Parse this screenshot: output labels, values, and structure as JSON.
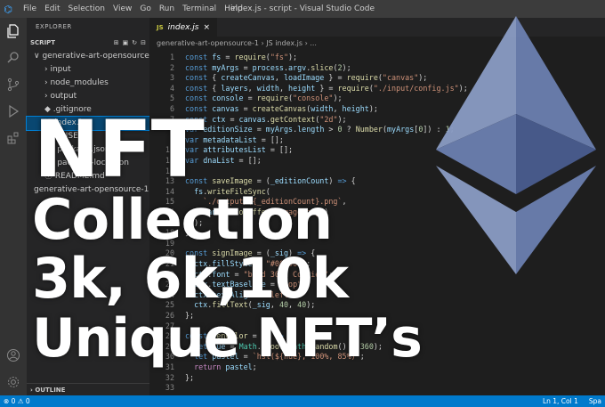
{
  "titlebar": {
    "logo": "⌬",
    "menus": [
      "File",
      "Edit",
      "Selection",
      "View",
      "Go",
      "Run",
      "Terminal",
      "Help"
    ],
    "window_title": "index.js - script - Visual Studio Code"
  },
  "activity": {
    "top": [
      "files-icon",
      "search-icon",
      "source-control-icon",
      "run-debug-icon",
      "extensions-icon"
    ],
    "bottom": [
      "account-icon",
      "settings-gear-icon"
    ]
  },
  "sidebar": {
    "header": "EXPLORER",
    "section": "SCRIPT",
    "tree": [
      {
        "label": "∨ generative-art-opensource-1",
        "indent": 0
      },
      {
        "label": "› input",
        "indent": 1
      },
      {
        "label": "› node_modules",
        "indent": 1
      },
      {
        "label": "› output",
        "indent": 1
      },
      {
        "label": "◆ .gitignore",
        "indent": 1
      },
      {
        "label": "JS index.js",
        "indent": 1,
        "selected": true
      },
      {
        "label": "LICENSE",
        "indent": 1
      },
      {
        "label": "{} package.json",
        "indent": 1
      },
      {
        "label": "{} package-lock.json",
        "indent": 1
      },
      {
        "label": "ⓘ README.md",
        "indent": 1
      },
      {
        "label": "generative-art-opensource-1.z...",
        "indent": 0
      }
    ],
    "outline": "OUTLINE"
  },
  "editor": {
    "tab_icon": "JS",
    "tab_name": "index.js",
    "tab_close": "×",
    "breadcrumb": "generative-art-opensource-1 › JS index.js › ..."
  },
  "code_lines": [
    {
      "n": "1",
      "html": "<span class='k'>const</span> <span class='v'>fs</span> = <span class='f'>require</span>(<span class='s'>\"fs\"</span>);"
    },
    {
      "n": "2",
      "html": "<span class='k'>const</span> <span class='v'>myArgs</span> = <span class='v'>process</span>.<span class='v'>argv</span>.<span class='f'>slice</span>(<span class='n'>2</span>);"
    },
    {
      "n": "3",
      "html": "<span class='k'>const</span> { <span class='v'>createCanvas</span>, <span class='v'>loadImage</span> } = <span class='f'>require</span>(<span class='s'>\"canvas\"</span>);"
    },
    {
      "n": "4",
      "html": "<span class='k'>const</span> { <span class='v'>layers</span>, <span class='v'>width</span>, <span class='v'>height</span> } = <span class='f'>require</span>(<span class='s'>\"./input/config.js\"</span>);"
    },
    {
      "n": "5",
      "html": "<span class='k'>const</span> <span class='v'>console</span> = <span class='f'>require</span>(<span class='s'>\"console\"</span>);"
    },
    {
      "n": "6",
      "html": "<span class='k'>const</span> <span class='v'>canvas</span> = <span class='f'>createCanvas</span>(<span class='v'>width</span>, <span class='v'>height</span>);"
    },
    {
      "n": "7",
      "html": "<span class='k'>const</span> <span class='v'>ctx</span> = <span class='v'>canvas</span>.<span class='f'>getContext</span>(<span class='s'>\"2d\"</span>);"
    },
    {
      "n": "8",
      "html": "<span class='k'>var</span> <span class='v'>editionSize</span> = <span class='v'>myArgs</span>.<span class='v'>length</span> &gt; <span class='n'>0</span> ? <span class='f'>Number</span>(<span class='v'>myArgs</span>[<span class='n'>0</span>]) : <span class='n'>1</span>;"
    },
    {
      "n": "9",
      "html": "<span class='k'>var</span> <span class='v'>metadataList</span> = [];"
    },
    {
      "n": "10",
      "html": "<span class='k'>var</span> <span class='v'>attributesList</span> = [];"
    },
    {
      "n": "11",
      "html": "<span class='k'>var</span> <span class='v'>dnaList</span> = [];"
    },
    {
      "n": "12",
      "html": ""
    },
    {
      "n": "13",
      "html": "<span class='k'>const</span> <span class='f'>saveImage</span> = (<span class='v'>_editionCount</span>) <span class='k'>=&gt;</span> {"
    },
    {
      "n": "14",
      "html": "  <span class='v'>fs</span>.<span class='f'>writeFileSync</span>("
    },
    {
      "n": "15",
      "html": "    <span class='s'>`./output/${_editionCount}.png`</span>,"
    },
    {
      "n": "16",
      "html": "    <span class='v'>canvas</span>.<span class='f'>toBuffer</span>(<span class='s'>\"image/png\"</span>)"
    },
    {
      "n": "17",
      "html": "  );"
    },
    {
      "n": "18",
      "html": "};"
    },
    {
      "n": "19",
      "html": ""
    },
    {
      "n": "20",
      "html": "<span class='k'>const</span> <span class='f'>signImage</span> = (<span class='v'>_sig</span>) <span class='k'>=&gt;</span> {"
    },
    {
      "n": "21",
      "html": "  <span class='v'>ctx</span>.<span class='v'>fillStyle</span> = <span class='s'>\"#000000\"</span>;"
    },
    {
      "n": "22",
      "html": "  <span class='v'>ctx</span>.<span class='v'>font</span> = <span class='s'>\"bold 30pt Courier\"</span>;"
    },
    {
      "n": "23",
      "html": "  <span class='v'>ctx</span>.<span class='v'>textBaseline</span> = <span class='s'>\"top\"</span>;"
    },
    {
      "n": "24",
      "html": "  <span class='v'>ctx</span>.<span class='v'>textAlign</span> = <span class='s'>\"left\"</span>;"
    },
    {
      "n": "25",
      "html": "  <span class='v'>ctx</span>.<span class='f'>fillText</span>(<span class='v'>_sig</span>, <span class='n'>40</span>, <span class='n'>40</span>);"
    },
    {
      "n": "26",
      "html": "};"
    },
    {
      "n": "27",
      "html": ""
    },
    {
      "n": "28",
      "html": "<span class='k'>const</span> <span class='f'>genColor</span> = () <span class='k'>=&gt;</span> {"
    },
    {
      "n": "29",
      "html": "  <span class='k'>let</span> <span class='v'>hue</span> = <span class='t'>Math</span>.<span class='f'>floor</span>(<span class='t'>Math</span>.<span class='f'>random</span>() * <span class='n'>360</span>);"
    },
    {
      "n": "30",
      "html": "  <span class='k'>let</span> <span class='v'>pastel</span> = <span class='s'>`hsl(${hue}, 100%, 85%)`</span>;"
    },
    {
      "n": "31",
      "html": "  <span class='c'>return</span> <span class='v'>pastel</span>;"
    },
    {
      "n": "32",
      "html": "};"
    },
    {
      "n": "33",
      "html": ""
    }
  ],
  "statusbar": {
    "left": "⊗ 0 ⚠ 0",
    "position": "Ln 1, Col 1",
    "spaces": "Spa"
  },
  "overlay": {
    "line1": "NFT",
    "line2": "Collection",
    "line3": "3k, 6k,10k",
    "line4": "Unique NFT’s"
  },
  "colors": {
    "accent": "#007acc",
    "eth_light": "#8a9cc4",
    "eth_mid": "#6c7fb0",
    "eth_dark": "#4a5d8f"
  }
}
